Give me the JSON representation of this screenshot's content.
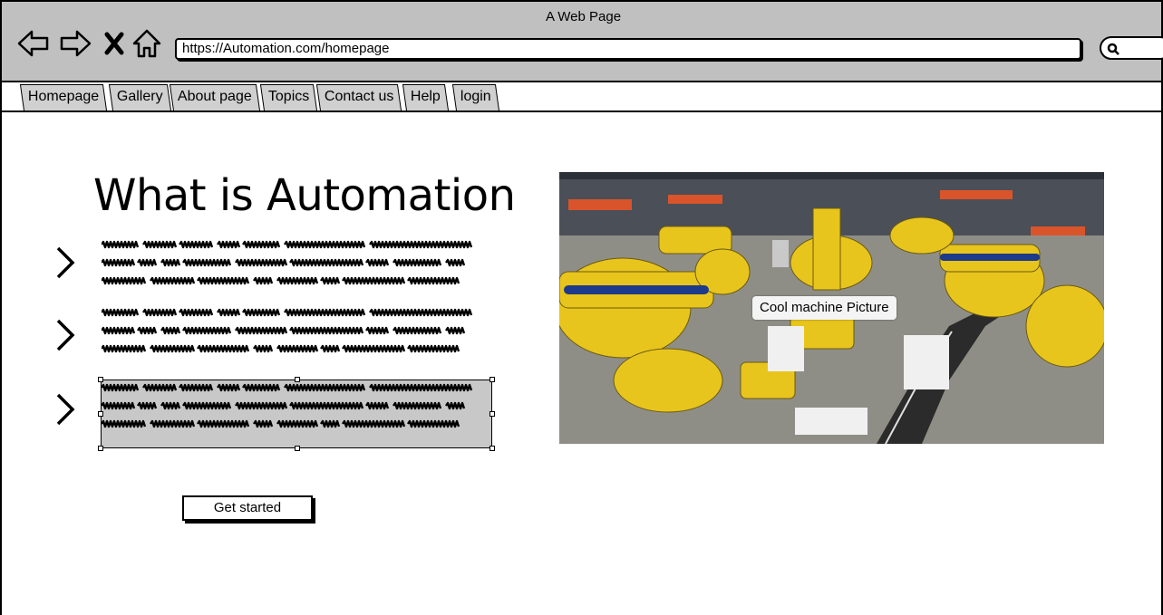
{
  "window": {
    "title": "A Web Page"
  },
  "browser": {
    "url": "https://Automation.com/homepage",
    "nav_icons": [
      "back-arrow-icon",
      "forward-arrow-icon",
      "close-icon",
      "home-icon"
    ],
    "search_icon": "search-icon"
  },
  "tabs": [
    {
      "label": "Homepage"
    },
    {
      "label": "Gallery"
    },
    {
      "label": "About page"
    },
    {
      "label": "Topics"
    },
    {
      "label": "Contact us"
    },
    {
      "label": "Help"
    },
    {
      "label": "login"
    }
  ],
  "main": {
    "heading": "What is Automation",
    "list_icon": "chevron-right-icon",
    "cta_label": "Get started",
    "picture_caption": "Cool machine Picture"
  },
  "colors": {
    "chrome": "#c0c0c0",
    "tab": "#d0d0d0",
    "selection": "#c8c8c8",
    "robot_yellow": "#e8c51c"
  }
}
